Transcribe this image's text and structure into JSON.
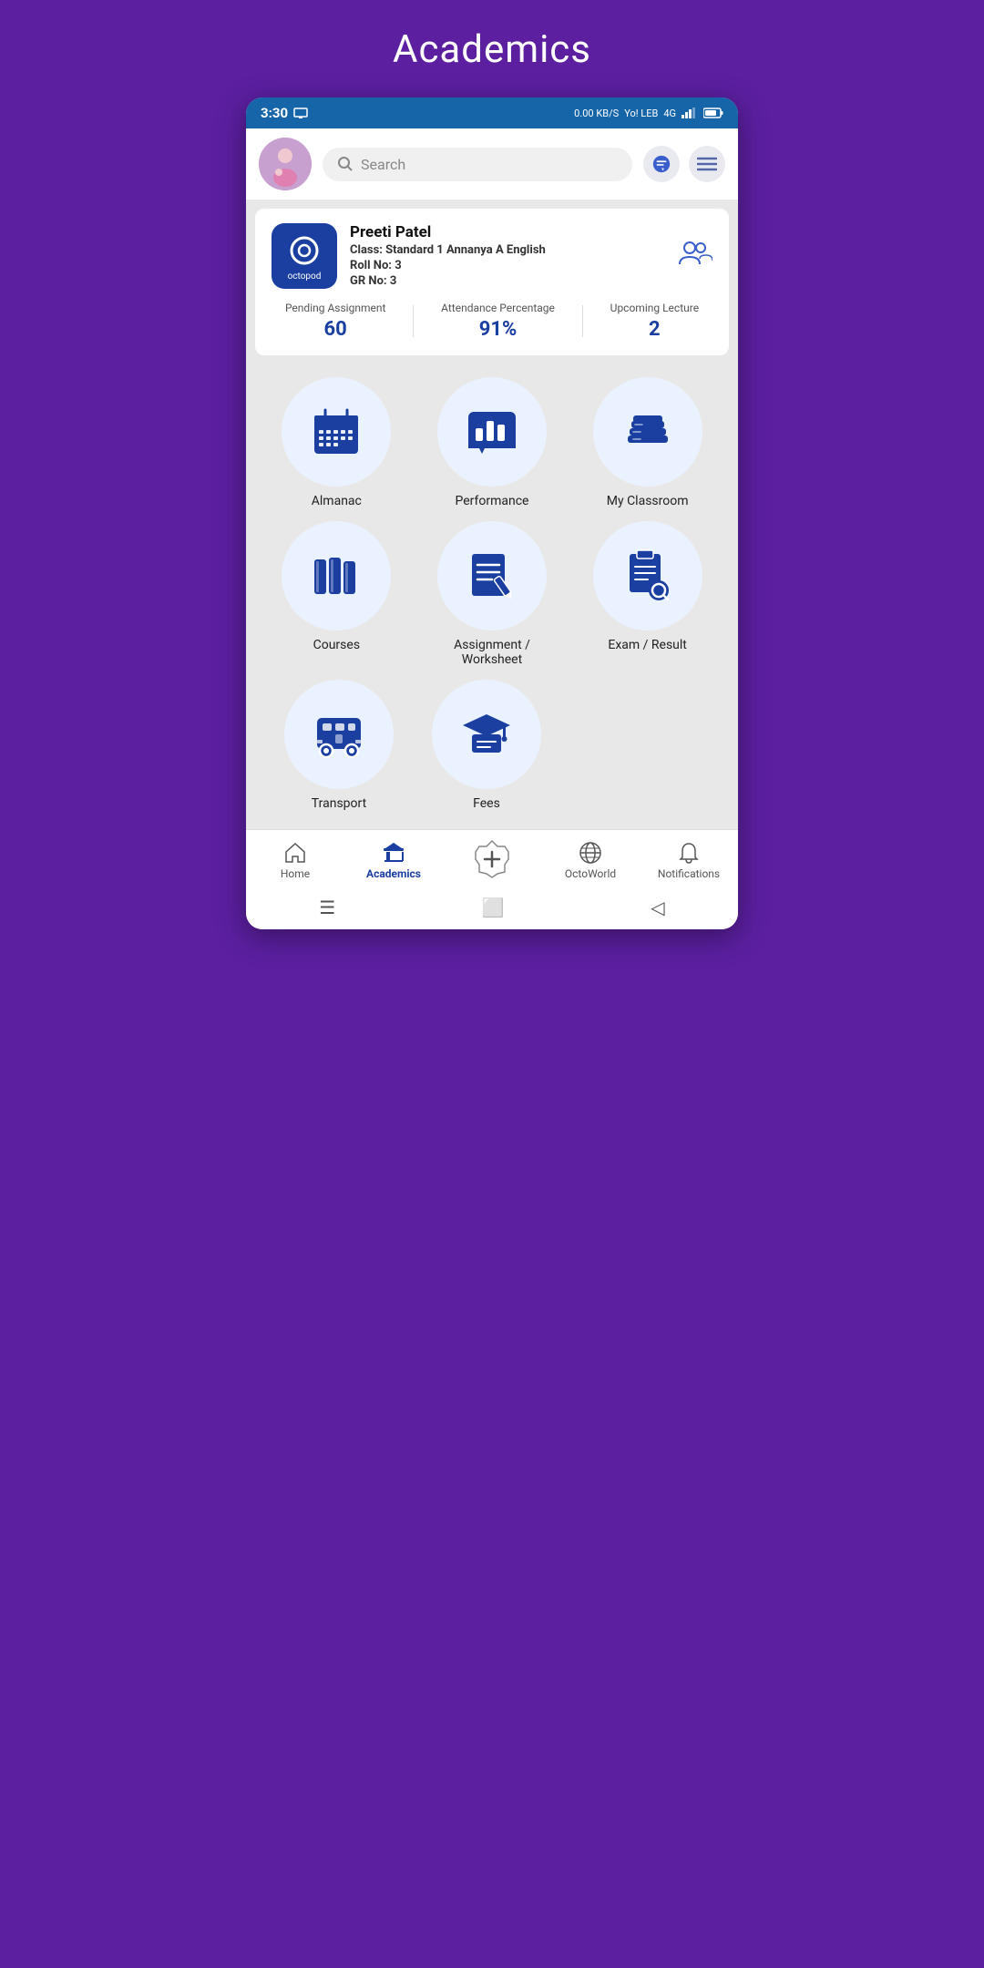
{
  "page_title": "Academics",
  "status_bar": {
    "time": "3:30",
    "network_speed": "0.00 KB/S",
    "carrier": "Yo! LEB",
    "signal": "4G"
  },
  "header": {
    "search_placeholder": "Search",
    "search_count": "0"
  },
  "profile": {
    "name": "Preeti Patel",
    "class_label": "Class:",
    "class_value": "Standard 1 Annanya A English",
    "roll_label": "Roll No:",
    "roll_value": "3",
    "gr_label": "GR No:",
    "gr_value": "3",
    "logo_text": "octopod"
  },
  "stats": [
    {
      "label": "Pending Assignment",
      "value": "60"
    },
    {
      "label": "Attendance Percentage",
      "value": "91%"
    },
    {
      "label": "Upcoming Lecture",
      "value": "2"
    }
  ],
  "grid_items": [
    {
      "label": "Almanac",
      "icon": "almanac"
    },
    {
      "label": "Performance",
      "icon": "performance"
    },
    {
      "label": "My Classroom",
      "icon": "classroom"
    },
    {
      "label": "Courses",
      "icon": "courses"
    },
    {
      "label": "Assignment / Worksheet",
      "icon": "assignment"
    },
    {
      "label": "Exam / Result",
      "icon": "exam"
    },
    {
      "label": "Transport",
      "icon": "transport"
    },
    {
      "label": "Fees",
      "icon": "fees"
    }
  ],
  "bottom_nav": [
    {
      "label": "Home",
      "icon": "home",
      "active": false
    },
    {
      "label": "Academics",
      "icon": "academics",
      "active": true
    },
    {
      "label": "",
      "icon": "plus-badge",
      "active": false
    },
    {
      "label": "OctoWorld",
      "icon": "world",
      "active": false
    },
    {
      "label": "Notifications",
      "icon": "bell",
      "active": false
    }
  ]
}
